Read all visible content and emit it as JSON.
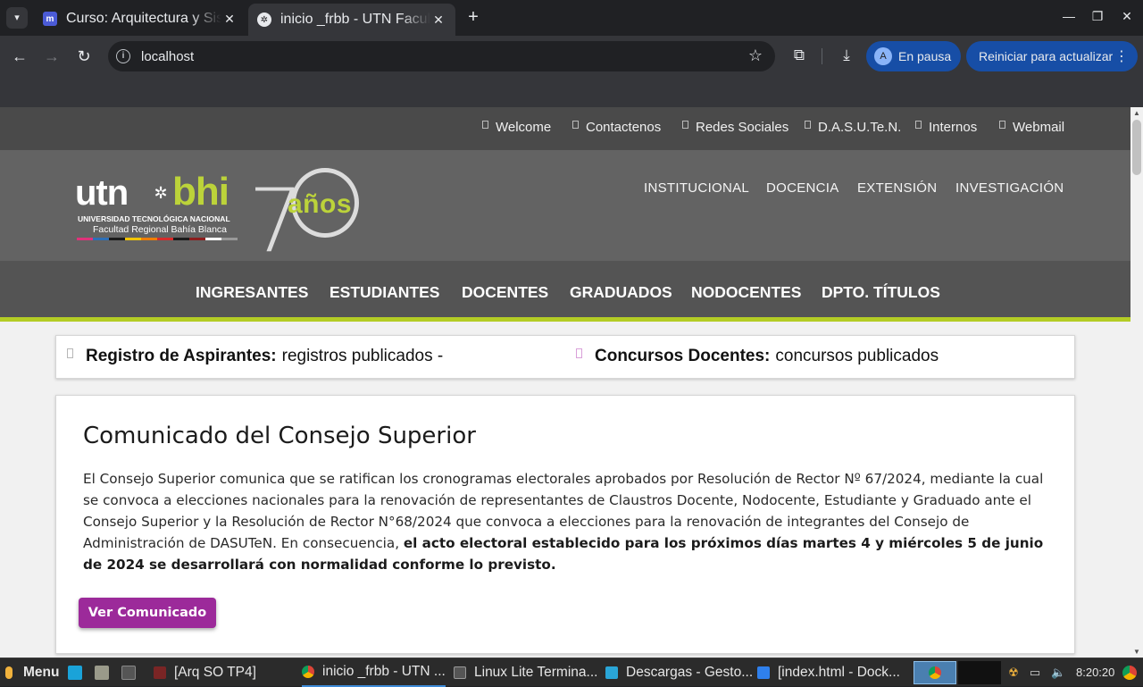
{
  "browser": {
    "tabs": [
      {
        "title": "Curso: Arquitectura y Sistemas Operativos",
        "favicon": "moodle-icon",
        "favicon_text": "m"
      },
      {
        "title": "inicio _frbb - UTN Facultad Regional Bahía Blanca",
        "favicon": "utn-icon",
        "favicon_text": "✲"
      }
    ],
    "new_tab": "+",
    "address": "localhost",
    "profile_initial": "A",
    "profile_status": "En pausa",
    "update_button": "Reiniciar para actualizar"
  },
  "site": {
    "topbar_links": [
      "Welcome",
      "Contactenos",
      "Redes Sociales",
      "D.A.S.U.Te.N.",
      "Internos",
      "Webmail"
    ],
    "logo": {
      "utn": "utn",
      "bhi": "bhi",
      "line1": "UNIVERSIDAD TECNOLÓGICA NACIONAL",
      "line2": "Facultad Regional Bahía Blanca",
      "anniversary_digit": "7",
      "anniversary_label": "años",
      "stripe_colors": [
        "#e0327a",
        "#2d6fb7",
        "#1a1a1a",
        "#f2c500",
        "#ef7d00",
        "#d62b2b",
        "#1a1a1a",
        "#8c1d1d",
        "#ffffff",
        "#999999"
      ]
    },
    "main_nav": [
      "INSTITUCIONAL",
      "DOCENCIA",
      "EXTENSIÓN",
      "INVESTIGACIÓN"
    ],
    "category_nav": [
      "INGRESANTES",
      "ESTUDIANTES",
      "DOCENTES",
      "GRADUADOS",
      "NODOCENTES",
      "DPTO. TÍTULOS"
    ],
    "ticker": [
      {
        "label": "Registro de Aspirantes:",
        "text": "registros publicados -"
      },
      {
        "label": "Concursos Docentes:",
        "text": "concursos publicados"
      }
    ],
    "announcement": {
      "title": "Comunicado del Consejo Superior",
      "body": "El Consejo Superior comunica que se ratifican los cronogramas electorales aprobados por Resolución de Rector Nº 67/2024, mediante la cual se convoca a elecciones nacionales para la renovación de representantes de Claustros Docente, Nodocente, Estudiante y Graduado ante el Consejo Superior y la Resolución de Rector N°68/2024 que convoca a elecciones para la renovación de integrantes del Consejo de Administración de DASUTeN. En consecuencia, ",
      "body_bold": "el acto electoral establecido para los próximos días martes 4 y miércoles 5 de junio de 2024 se desarrollará con normalidad conforme lo previsto.",
      "button": "Ver Comunicado"
    },
    "colors": {
      "accent_green": "#b4cc25",
      "button_purple": "#9c2a9a",
      "header_gray": "#636363"
    }
  },
  "taskbar": {
    "menu": "Menu",
    "items": [
      {
        "label": "[Arq SO TP4]",
        "icon": "window-icon"
      },
      {
        "label": "inicio _frbb - UTN ...",
        "icon": "chrome-icon"
      },
      {
        "label": "Linux Lite Termina...",
        "icon": "terminal-icon"
      },
      {
        "label": "Descargas - Gesto...",
        "icon": "folder-icon"
      },
      {
        "label": "[index.html - Dock...",
        "icon": "vscode-icon"
      }
    ],
    "clock": "8:20:20"
  }
}
